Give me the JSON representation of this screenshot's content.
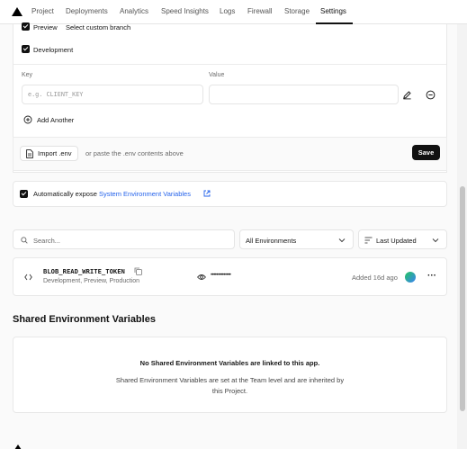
{
  "nav": {
    "tabs": [
      "Project",
      "Deployments",
      "Analytics",
      "Speed Insights",
      "Logs",
      "Firewall",
      "Storage",
      "Settings"
    ],
    "active_tab": "Settings"
  },
  "env_form": {
    "preview_label": "Preview",
    "custom_branch_link": "Select custom branch",
    "development_label": "Development",
    "key_label": "Key",
    "value_label": "Value",
    "key_placeholder": "e.g. CLIENT_KEY",
    "add_another": "Add Another",
    "import_env": "Import .env",
    "import_hint": "or paste the .env contents above",
    "save": "Save"
  },
  "auto_expose": {
    "label": "Automatically expose",
    "link": "System Environment Variables"
  },
  "filters": {
    "search_placeholder": "Search...",
    "environment": "All Environments",
    "sort": "Last Updated"
  },
  "variables": [
    {
      "name": "BLOB_READ_WRITE_TOKEN",
      "environments": "Development, Preview, Production",
      "value_masked": "••••••••••••••",
      "added": "Added 16d ago"
    }
  ],
  "shared": {
    "heading": "Shared Environment Variables",
    "empty_title": "No Shared Environment Variables are linked to this app.",
    "empty_desc_line1": "Shared Environment Variables are set at the Team level and are inherited by",
    "empty_desc_line2": "this Project."
  },
  "colors": {
    "accent": "#111111",
    "link": "#2563eb",
    "avatar_from": "#22c55e",
    "avatar_to": "#3b82f6"
  }
}
